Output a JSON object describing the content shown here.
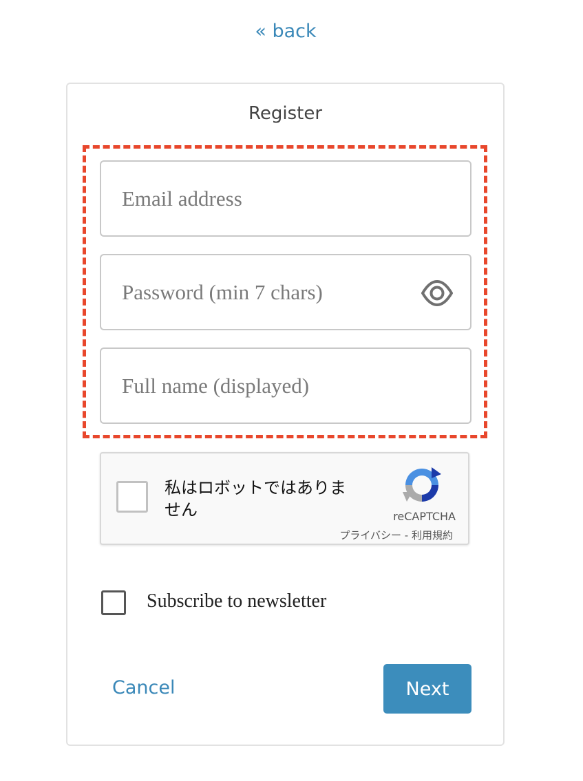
{
  "nav": {
    "back_label": "« back"
  },
  "form": {
    "title": "Register",
    "fields": {
      "email": {
        "placeholder": "Email address",
        "value": ""
      },
      "password": {
        "placeholder": "Password (min 7 chars)",
        "value": "",
        "toggle_icon": "eye-icon"
      },
      "full_name": {
        "placeholder": "Full name (displayed)",
        "value": ""
      }
    },
    "highlight_color": "#e8472c"
  },
  "recaptcha": {
    "checkbox_label": "私はロボットではありません",
    "brand": "reCAPTCHA",
    "privacy_link": "プライバシー",
    "separator": " - ",
    "terms_link": "利用規約",
    "checked": false
  },
  "newsletter": {
    "label": "Subscribe to newsletter",
    "checked": false
  },
  "actions": {
    "cancel_label": "Cancel",
    "next_label": "Next"
  },
  "colors": {
    "accent": "#3c8dbc",
    "link": "#3a88b8"
  }
}
